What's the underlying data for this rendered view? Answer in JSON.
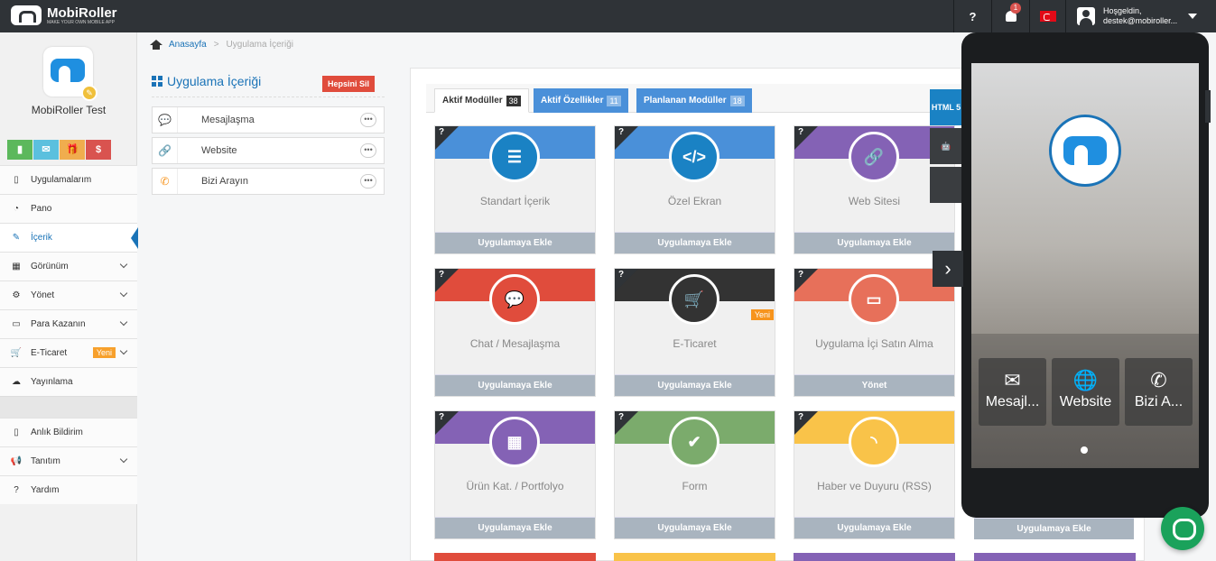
{
  "topbar": {
    "brand": "MobiRoller",
    "tagline": "MAKE YOUR OWN MOBILE APP",
    "help_label": "?",
    "notification_count": "1",
    "greeting": "Hoşgeldin,",
    "user_email": "destek@mobiroller..."
  },
  "sidebar": {
    "app_name": "MobiRoller Test",
    "quick_buttons": [
      {
        "icon": "chart-icon",
        "color": "#5cb85c"
      },
      {
        "icon": "mail-icon",
        "color": "#5bc0de"
      },
      {
        "icon": "gift-icon",
        "color": "#f0ad4e"
      },
      {
        "icon": "dollar-icon",
        "color": "#d9534f",
        "label": "$"
      }
    ],
    "items": [
      {
        "label": "Uygulamalarım",
        "icon": "mobile-icon"
      },
      {
        "label": "Pano",
        "icon": "dashboard-icon"
      },
      {
        "label": "İçerik",
        "icon": "edit-icon",
        "active": true
      },
      {
        "label": "Görünüm",
        "icon": "grid-icon",
        "chevron": true
      },
      {
        "label": "Yönet",
        "icon": "gears-icon",
        "chevron": true
      },
      {
        "label": "Para Kazanın",
        "icon": "money-icon",
        "chevron": true
      },
      {
        "label": "E-Ticaret",
        "icon": "cart-icon",
        "chevron": true,
        "badge": "Yeni"
      },
      {
        "label": "Yayınlama",
        "icon": "cloud-upload-icon"
      }
    ],
    "items2": [
      {
        "label": "Anlık Bildirim",
        "icon": "mobile-icon"
      },
      {
        "label": "Tanıtım",
        "icon": "bullhorn-icon",
        "chevron": true
      },
      {
        "label": "Yardım",
        "icon": "question-icon"
      }
    ]
  },
  "breadcrumb": {
    "home": "Anasayfa",
    "current": "Uygulama İçeriği"
  },
  "content": {
    "title": "Uygulama İçeriği",
    "delete_all": "Hepsini Sil",
    "items": [
      {
        "label": "Mesajlaşma",
        "icon": "chat-icon",
        "color": "#e04c3c"
      },
      {
        "label": "Website",
        "icon": "link-icon",
        "color": "#8e6ec8"
      },
      {
        "label": "Bizi Arayın",
        "icon": "phone-icon",
        "color": "#f7941d"
      }
    ]
  },
  "tabs": [
    {
      "label": "Aktif Modüller",
      "count": "38"
    },
    {
      "label": "Aktif Özellikler",
      "count": "11"
    },
    {
      "label": "Planlanan Modüller",
      "count": "18"
    }
  ],
  "modules": [
    {
      "name": "Standart İçerik",
      "footer": "Uygulamaya Ekle",
      "color": "#4a90d9",
      "circle": "#1a82c4",
      "icon": "list-icon"
    },
    {
      "name": "Özel Ekran",
      "footer": "Uygulamaya Ekle",
      "color": "#4a90d9",
      "circle": "#1a82c4",
      "icon": "code-icon"
    },
    {
      "name": "Web Sitesi",
      "footer": "Uygulamaya Ekle",
      "color": "#8462b5",
      "circle": "#8462b5",
      "icon": "link-icon"
    },
    {
      "name": "Chat / Mesajlaşma",
      "footer": "Uygulamaya Ekle",
      "color": "#e04c3c",
      "circle": "#e04c3c",
      "icon": "chat-icon"
    },
    {
      "name": "E-Ticaret",
      "footer": "Uygulamaya Ekle",
      "color": "#333333",
      "circle": "#333333",
      "icon": "cart-icon",
      "badge": "Yeni"
    },
    {
      "name": "Uygulama İçi Satın Alma",
      "footer": "Yönet",
      "color": "#e7705a",
      "circle": "#e7705a",
      "icon": "money-icon"
    },
    {
      "name": "Ürün Kat. / Portfolyo",
      "footer": "Uygulamaya Ekle",
      "color": "#8462b5",
      "circle": "#8462b5",
      "icon": "grid-icon"
    },
    {
      "name": "Form",
      "footer": "Uygulamaya Ekle",
      "color": "#7bab6c",
      "circle": "#7bab6c",
      "icon": "check-icon"
    },
    {
      "name": "Haber ve Duyuru (RSS)",
      "footer": "Uygulamaya Ekle",
      "color": "#f9c349",
      "circle": "#f9c349",
      "icon": "rss-icon"
    }
  ],
  "extra_footer": "Uygulamaya Ekle",
  "platforms": [
    {
      "name": "html5-icon",
      "label": "HTML 5",
      "color": "#1a82c4"
    },
    {
      "name": "android-icon",
      "color": "#3a3d40"
    },
    {
      "name": "apple-icon",
      "color": "#3a3d40"
    }
  ],
  "preview": {
    "tiles": [
      {
        "label": "Mesajl...",
        "icon": "mail-icon"
      },
      {
        "label": "Website",
        "icon": "globe-icon"
      },
      {
        "label": "Bizi A...",
        "icon": "phone-icon"
      }
    ]
  }
}
